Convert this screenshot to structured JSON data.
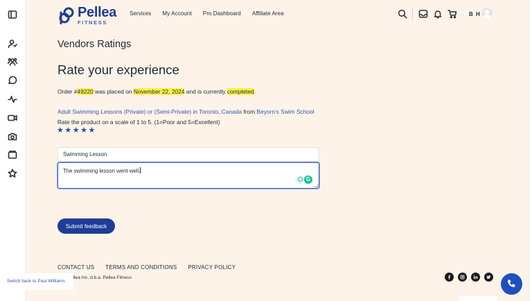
{
  "header": {
    "logo_name": "Pellea",
    "logo_sub": "FITNESS",
    "nav": [
      "Services",
      "My Account",
      "Pro Dashboard",
      "Affiliate Area"
    ],
    "user_initials": "B H",
    "icons": [
      "search-icon",
      "inbox-icon",
      "bell-icon",
      "cart-icon"
    ]
  },
  "sidebar": {
    "icons": [
      "sidebar-toggle-icon",
      "user-icon",
      "groups-icon",
      "chat-icon",
      "activity-icon",
      "video-icon",
      "camera-icon",
      "folder-icon",
      "star-icon"
    ]
  },
  "page": {
    "heading": "Vendors Ratings",
    "title": "Rate your experience",
    "order": {
      "prefix": "Order #",
      "number": "49220",
      "mid": " was placed on ",
      "date": "November 22, 2024",
      "mid2": " and is currently ",
      "status": "completed",
      "suffix": "."
    },
    "product": {
      "name": "Adult Swimming Lessons (Private) or (Semi-Private) in Toronto, Canada",
      "from": " from ",
      "vendor": "Beyorn's Swim School"
    },
    "scale_text": "Rate the product on a scale of 1 to 5. (1=Poor and 5=Excellent)",
    "rating": 5,
    "stars": [
      "★",
      "★",
      "★",
      "★",
      "★"
    ],
    "title_value": "Swimming Lesson",
    "review_value": "The swimming lesson went well.",
    "submit_label": "Submit feedback"
  },
  "footer": {
    "links": [
      "CONTACT US",
      "TERMS AND CONDITIONS",
      "PRIVACY POLICY"
    ],
    "copyright": "4 - Pellea Inc. d.b.a. Pellea Fitness",
    "switch_back": "Switch back to Paul Williams",
    "social": [
      "facebook-icon",
      "instagram-icon",
      "linkedin-icon",
      "twitter-icon"
    ]
  },
  "colors": {
    "brand": "#1e3d97",
    "background": "#fdf3e8",
    "highlight": "#fbf24a",
    "link": "#3852b8",
    "star": "#2547b4",
    "call": "#1e4fbf"
  }
}
